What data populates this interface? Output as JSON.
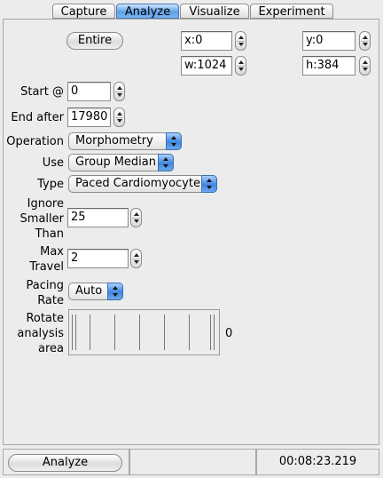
{
  "tabs": [
    {
      "label": "Capture",
      "active": false
    },
    {
      "label": "Analyze",
      "active": true
    },
    {
      "label": "Visualize",
      "active": false
    },
    {
      "label": "Experiment",
      "active": false
    }
  ],
  "region": {
    "entire_label": "Entire",
    "x": "x:0",
    "y": "y:0",
    "w": "w:1024",
    "h": "h:384"
  },
  "form": {
    "start_label": "Start @",
    "start_value": "0",
    "end_label": "End after",
    "end_value": "17980",
    "operation_label": "Operation",
    "operation_value": "Morphometry",
    "use_label": "Use",
    "use_value": "Group Median",
    "type_label": "Type",
    "type_value": "Paced Cardiomyocyte",
    "ignore_label_1": "Ignore",
    "ignore_label_2": "Smaller",
    "ignore_label_3": "Than",
    "ignore_value": "25",
    "max_label_1": "Max",
    "max_label_2": "Travel",
    "max_value": "2",
    "pacing_label_1": "Pacing",
    "pacing_label_2": "Rate",
    "pacing_value": "Auto",
    "rotate_label_1": "Rotate",
    "rotate_label_2": "analysis",
    "rotate_label_3": "area",
    "rotate_value": "0"
  },
  "status": {
    "analyze_label": "Analyze",
    "middle_text": "",
    "elapsed": "00:08:23.219"
  },
  "colors": {
    "accent": "#5fa0e6",
    "background": "#ececec"
  }
}
